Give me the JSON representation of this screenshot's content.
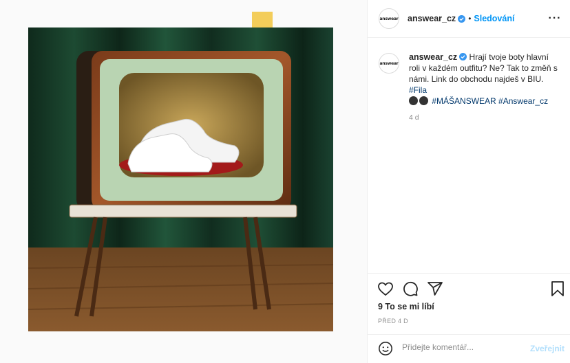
{
  "post": {
    "username": "answear_cz",
    "follow_label": "Sledování",
    "avatar_text": "answear",
    "more_icon": "more-horizontal-icon",
    "verified_icon": "verified-badge-icon"
  },
  "caption": {
    "username": "answear_cz",
    "text": "Hrají tvoje boty hlavní roli v každém outfitu? Ne? Tak to změň s námi. Link do obchodu najdeš v BIU.",
    "hashtag_fila": "#Fila",
    "hashtag_masanswear": "#MÁŠANSWEAR",
    "hashtag_answear": "#Answear_cz",
    "time": "4 d"
  },
  "actions": {
    "like_icon": "heart-icon",
    "comment_icon": "comment-icon",
    "share_icon": "share-icon",
    "save_icon": "bookmark-icon",
    "likes": "9 To se mi líbí",
    "posted": "PŘED 4 D"
  },
  "comment": {
    "emoji_icon": "smiley-icon",
    "placeholder": "Přidejte komentář...",
    "post_label": "Zveřejnit"
  },
  "colors": {
    "accent": "#0095f6",
    "hashtag": "#00376b",
    "post_disabled": "#b2dffc",
    "sticky_note": "#f3cd5a"
  }
}
